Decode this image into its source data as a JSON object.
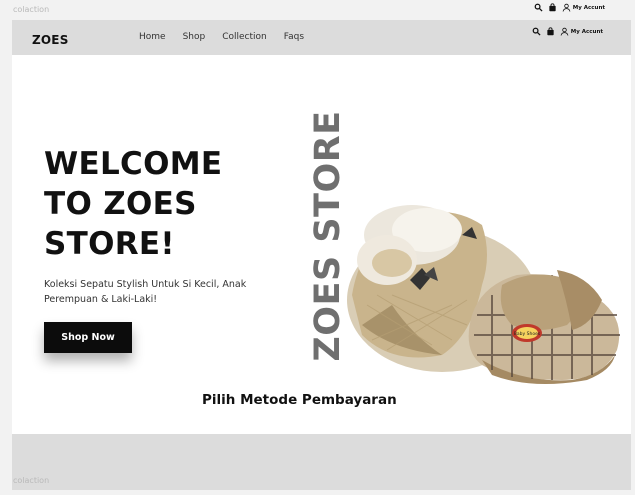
{
  "outer": {
    "label_top": "colaction",
    "label_bottom": "colaction",
    "account": "My Accunt"
  },
  "header": {
    "brand": "ZOES",
    "nav": [
      "Home",
      "Shop",
      "Collection",
      "Faqs"
    ],
    "account": "My Accunt",
    "icons": [
      "search-icon",
      "bag-icon",
      "user-icon"
    ]
  },
  "hero": {
    "title_lines": [
      "WELCOME",
      "TO ZOES",
      "STORE!"
    ],
    "subtitle_lines": [
      "Koleksi Sepatu Stylish Untuk Si Kecil, Anak",
      "Perempuan & Laki-Laki!"
    ],
    "cta": "Shop Now",
    "vertical_text": "ZOES STORE",
    "shoe_badge": "Baby Shoes"
  },
  "payment": {
    "title": "Pilih Metode Pembayaran"
  },
  "colors": {
    "navbar": "#dcdcdc",
    "cta": "#0c0c0c",
    "vertical": "#6f6f6f"
  }
}
